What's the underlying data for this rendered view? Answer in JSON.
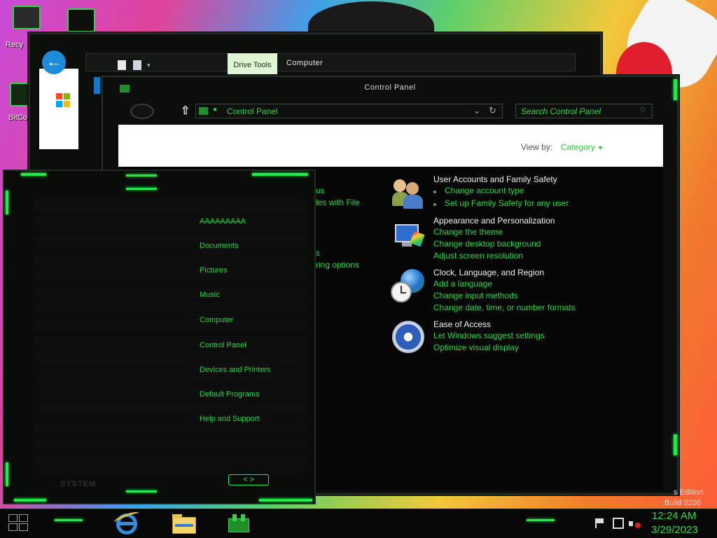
{
  "desktop": {
    "icons": [
      {
        "label": "Recy",
        "icon": "recycle-bin-icon"
      },
      {
        "label": "BitCo",
        "icon": "bitcoin-icon"
      }
    ],
    "watermark_line1": "s Edition",
    "watermark_line2": "Build 9200"
  },
  "back_window": {
    "ribbon_tab": "Drive Tools",
    "title": "Computer",
    "back_icon": "back-arrow-icon"
  },
  "control_panel": {
    "title": "Control Panel",
    "address": "Control Panel",
    "search_placeholder": "Search Control Panel",
    "view_by_label": "View by:",
    "view_by_value": "Category",
    "left_fragments": [
      "us",
      "les with File",
      "s",
      "ring options"
    ],
    "categories": [
      {
        "title": "User Accounts and Family Safety",
        "icon": "user-accounts-icon",
        "links": [
          "Change account type",
          "Set up Family Safety for any user"
        ]
      },
      {
        "title": "Appearance and Personalization",
        "icon": "appearance-icon",
        "links": [
          "Change the theme",
          "Change desktop background",
          "Adjust screen resolution"
        ]
      },
      {
        "title": "Clock, Language, and Region",
        "icon": "clock-globe-icon",
        "links": [
          "Add a language",
          "Change input methods",
          "Change date, time, or number formats"
        ]
      },
      {
        "title": "Ease of Access",
        "icon": "ease-of-access-icon",
        "links": [
          "Let Windows suggest settings",
          "Optimize visual display"
        ]
      }
    ]
  },
  "start_menu": {
    "items": [
      "AAAAAAAAA",
      "Documents",
      "Pictures",
      "Music",
      "Computer",
      "Control Panel",
      "Devices and Printers",
      "Default Programs",
      "Help and Support"
    ],
    "footer": "SYSTEM",
    "nav": "< >"
  },
  "taskbar": {
    "time": "12:24 AM",
    "date": "3/29/2023",
    "pinned": [
      "internet-explorer-icon",
      "file-explorer-icon",
      "control-panel-icon"
    ]
  },
  "colors": {
    "accent_green": "#27d845",
    "frame": "#0c0e0c"
  }
}
